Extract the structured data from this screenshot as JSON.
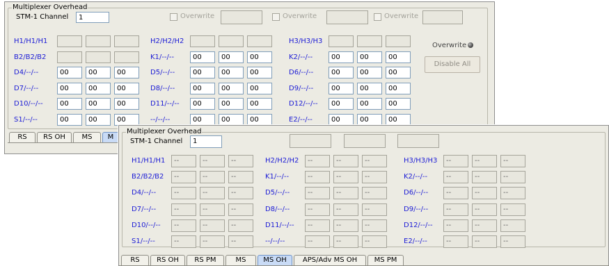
{
  "back_panel": {
    "group_title": "Multiplexer Overhead",
    "stm_label": "STM-1 Channel",
    "stm_value": "1",
    "overwrite_label": "Overwrite",
    "overwrite_status_label": "Overwrite",
    "disable_all_label": "Disable All",
    "rows": [
      [
        "H1/H1/H1",
        "H2/H2/H2",
        "H3/H3/H3"
      ],
      [
        "B2/B2/B2",
        "K1/--/--",
        "K2/--/--"
      ],
      [
        "D4/--/--",
        "D5/--/--",
        "D6/--/--"
      ],
      [
        "D7/--/--",
        "D8/--/--",
        "D9/--/--"
      ],
      [
        "D10/--/--",
        "D11/--/--",
        "D12/--/--"
      ],
      [
        "S1/--/--",
        "--/--/--",
        "E2/--/--"
      ]
    ],
    "values": [
      [
        [
          "",
          "",
          ""
        ],
        [
          "",
          "",
          ""
        ],
        [
          "",
          "",
          ""
        ]
      ],
      [
        [
          "",
          "",
          ""
        ],
        [
          "00",
          "00",
          "00"
        ],
        [
          "00",
          "00",
          "00"
        ]
      ],
      [
        [
          "00",
          "00",
          "00"
        ],
        [
          "00",
          "00",
          "00"
        ],
        [
          "00",
          "00",
          "00"
        ]
      ],
      [
        [
          "00",
          "00",
          "00"
        ],
        [
          "00",
          "00",
          "00"
        ],
        [
          "00",
          "00",
          "00"
        ]
      ],
      [
        [
          "00",
          "00",
          "00"
        ],
        [
          "00",
          "00",
          "00"
        ],
        [
          "00",
          "00",
          "00"
        ]
      ],
      [
        [
          "00",
          "00",
          "00"
        ],
        [
          "00",
          "00",
          "00"
        ],
        [
          "00",
          "00",
          "00"
        ]
      ]
    ],
    "tabs": [
      "RS",
      "RS OH",
      "MS",
      "M"
    ]
  },
  "front_panel": {
    "group_title": "Multiplexer Overhead",
    "stm_label": "STM-1 Channel",
    "stm_value": "1",
    "rows": [
      [
        "H1/H1/H1",
        "H2/H2/H2",
        "H3/H3/H3"
      ],
      [
        "B2/B2/B2",
        "K1/--/--",
        "K2/--/--"
      ],
      [
        "D4/--/--",
        "D5/--/--",
        "D6/--/--"
      ],
      [
        "D7/--/--",
        "D8/--/--",
        "D9/--/--"
      ],
      [
        "D10/--/--",
        "D11/--/--",
        "D12/--/--"
      ],
      [
        "S1/--/--",
        "--/--/--",
        "E2/--/--"
      ]
    ],
    "cell_value": "--",
    "tabs": [
      "RS",
      "RS OH",
      "RS PM",
      "MS",
      "MS OH",
      "APS/Adv MS OH",
      "MS PM"
    ],
    "active_tab": "MS OH"
  },
  "colors": {
    "row_label": "#1b1bd6",
    "panel_bg": "#ecebe3",
    "active_tab": "#c9dbf6"
  }
}
